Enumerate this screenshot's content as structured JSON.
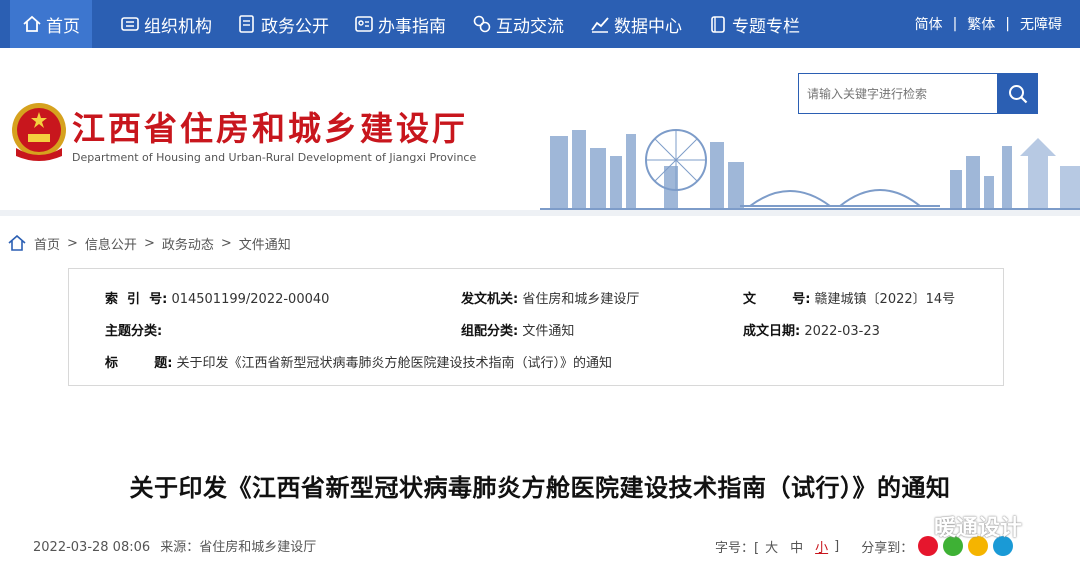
{
  "nav": {
    "items": [
      {
        "label": "首页",
        "icon": "home-icon"
      },
      {
        "label": "组织机构",
        "icon": "org-icon"
      },
      {
        "label": "政务公开",
        "icon": "document-icon"
      },
      {
        "label": "办事指南",
        "icon": "id-card-icon"
      },
      {
        "label": "互动交流",
        "icon": "chat-icon"
      },
      {
        "label": "数据中心",
        "icon": "chart-icon"
      },
      {
        "label": "专题专栏",
        "icon": "folder-icon"
      }
    ],
    "langs": [
      "简体",
      "繁体",
      "无障碍"
    ],
    "sep": "|",
    "colors": {
      "bar": "#2b5fb3",
      "active": "#3d76cf"
    }
  },
  "header": {
    "title": "江西省住房和城乡建设厅",
    "subtitle": "Department of Housing and Urban-Rural Development of Jiangxi Province",
    "search_placeholder": "请输入关键字进行检索",
    "title_color": "#c8161d"
  },
  "breadcrumb": {
    "items": [
      "首页",
      "信息公开",
      "政务动态",
      "文件通知"
    ],
    "sep": ">"
  },
  "info": {
    "index_label": "索  引  号:",
    "index_value": "014501199/2022-00040",
    "issuer_label": "发文机关:",
    "issuer_value": "省住房和城乡建设厅",
    "doc_label": "文        号:",
    "doc_value": "赣建城镇〔2022〕14号",
    "topic_label": "主题分类:",
    "topic_value": "",
    "category_label": "组配分类:",
    "category_value": "文件通知",
    "date_label": "成文日期:",
    "date_value": "2022-03-23",
    "title_label": "标        题:",
    "title_value": "关于印发《江西省新型冠状病毒肺炎方舱医院建设技术指南（试行）》的通知"
  },
  "article": {
    "title": "关于印发《江西省新型冠状病毒肺炎方舱医院建设技术指南（试行）》的通知",
    "datetime": "2022-03-28 08:06",
    "source": "来源：省住房和城乡建设厅",
    "fontsize_label": "字号：[",
    "fs_large": "大",
    "fs_medium": "中",
    "fs_small": "小",
    "fs_close": "]",
    "share_label": "分享到：",
    "share_icons": [
      "weibo-icon",
      "wechat-icon",
      "qzone-icon",
      "qq-icon"
    ]
  },
  "watermark": {
    "text": "暖通设计"
  }
}
